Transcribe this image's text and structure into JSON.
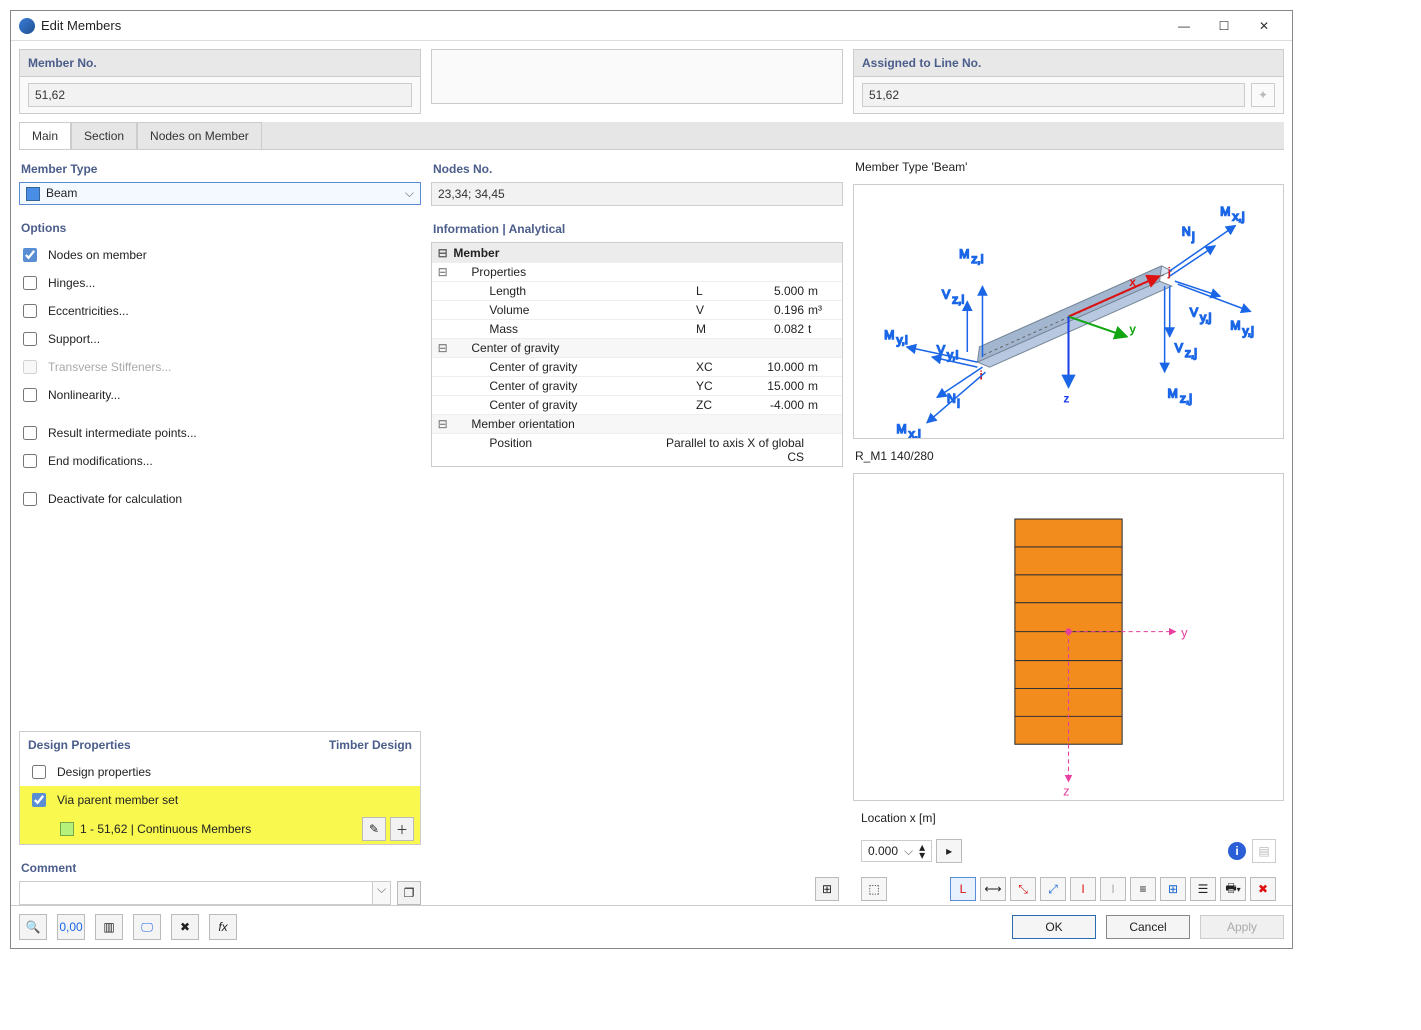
{
  "window": {
    "title": "Edit Members"
  },
  "top": {
    "member_no_label": "Member No.",
    "member_no_value": "51,62",
    "assigned_label": "Assigned to Line No.",
    "assigned_value": "51,62"
  },
  "tabs": [
    "Main",
    "Section",
    "Nodes on Member"
  ],
  "member_type": {
    "label": "Member Type",
    "value": "Beam"
  },
  "options": {
    "label": "Options",
    "items": [
      {
        "label": "Nodes on member",
        "checked": true
      },
      {
        "label": "Hinges...",
        "checked": false
      },
      {
        "label": "Eccentricities...",
        "checked": false
      },
      {
        "label": "Support...",
        "checked": false
      },
      {
        "label": "Transverse Stiffeners...",
        "checked": false,
        "disabled": true
      },
      {
        "label": "Nonlinearity...",
        "checked": false
      },
      {
        "label": "Result intermediate points...",
        "checked": false
      },
      {
        "label": "End modifications...",
        "checked": false
      },
      {
        "label": "Deactivate for calculation",
        "checked": false
      }
    ]
  },
  "nodes_no": {
    "label": "Nodes No.",
    "value": "23,34; 34,45"
  },
  "info": {
    "label": "Information | Analytical",
    "member": "Member",
    "properties": "Properties",
    "rows_props": [
      {
        "k": "Length",
        "s": "L",
        "v": "5.000",
        "u": "m"
      },
      {
        "k": "Volume",
        "s": "V",
        "v": "0.196",
        "u": "m³"
      },
      {
        "k": "Mass",
        "s": "M",
        "v": "0.082",
        "u": "t"
      }
    ],
    "cog": "Center of gravity",
    "rows_cog": [
      {
        "k": "Center of gravity",
        "s": "XC",
        "v": "10.000",
        "u": "m"
      },
      {
        "k": "Center of gravity",
        "s": "YC",
        "v": "15.000",
        "u": "m"
      },
      {
        "k": "Center of gravity",
        "s": "ZC",
        "v": "-4.000",
        "u": "m"
      }
    ],
    "orient": "Member orientation",
    "orient_row": {
      "k": "Position",
      "v": "Parallel to axis X of global CS"
    }
  },
  "design": {
    "label": "Design Properties",
    "right": "Timber Design",
    "chk1": "Design properties",
    "chk2": "Via parent member set",
    "set_label": "1 - 51,62 | Continuous Members"
  },
  "preview": {
    "type_label": "Member Type 'Beam'",
    "section_label": "R_M1 140/280",
    "location_label": "Location x [m]",
    "location_value": "0.000"
  },
  "comment": {
    "label": "Comment"
  },
  "buttons": {
    "ok": "OK",
    "cancel": "Cancel",
    "apply": "Apply"
  },
  "icons": {
    "minimize": "minimize-icon",
    "maximize": "maximize-icon",
    "close": "close-icon"
  }
}
